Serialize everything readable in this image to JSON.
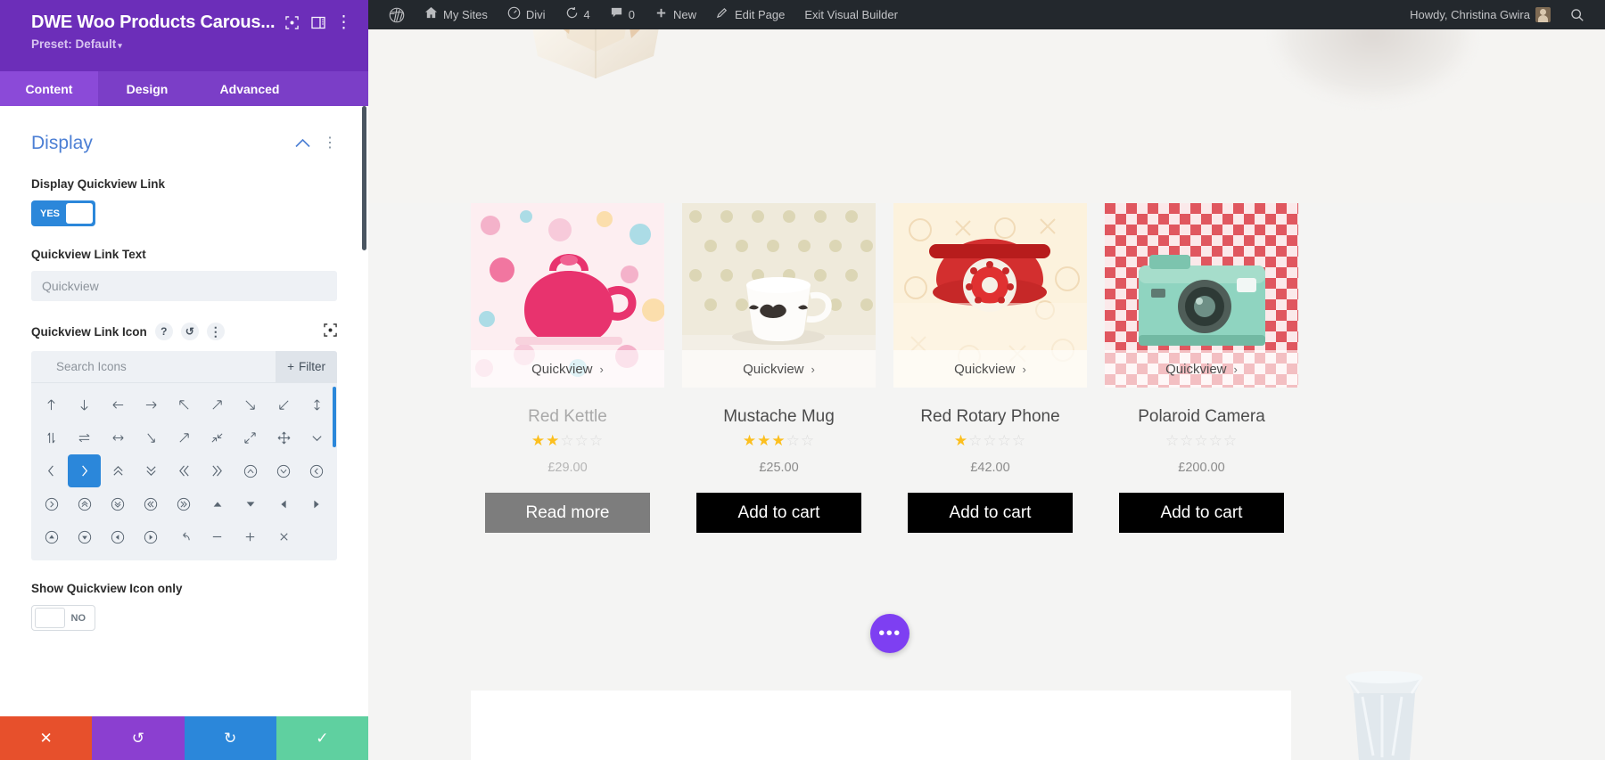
{
  "panel": {
    "title": "DWE Woo Products Carous...",
    "preset": "Preset: Default",
    "preset_caret": "▾",
    "icons": {
      "expand": "⛶",
      "layout": "▥",
      "dots": "⋮"
    },
    "tabs": [
      {
        "label": "Content",
        "active": true
      },
      {
        "label": "Design",
        "active": false
      },
      {
        "label": "Advanced",
        "active": false
      }
    ],
    "section": {
      "title": "Display",
      "chevron": "⌃",
      "dots": "⋮"
    },
    "fields": {
      "display_quickview_link": {
        "label": "Display Quickview Link",
        "value": "YES"
      },
      "quickview_link_text": {
        "label": "Quickview Link Text",
        "placeholder": "Quickview",
        "value": ""
      },
      "quickview_link_icon": {
        "label": "Quickview Link Icon",
        "help": "?",
        "reset": "↺",
        "dots": "⋮",
        "expand": "⛶",
        "search_placeholder": "Search Icons",
        "filter_label": "Filter",
        "filter_plus": "+",
        "selected_index": 20
      },
      "show_quickview_icon_only": {
        "label": "Show Quickview Icon only",
        "value": "NO"
      }
    },
    "icon_grid": [
      "↑",
      "↓",
      "←",
      "→",
      "↖",
      "↗",
      "↘",
      "↙",
      "↕",
      "⇕",
      "⇌",
      "↔",
      "⇲",
      "⇗",
      "⇲",
      "⇱",
      "⤢",
      "✥",
      "⌄",
      "‹",
      "›",
      "⌃⌃",
      "⌄⌄",
      "«",
      "»",
      "⌃",
      "⌄",
      "‹",
      "›",
      "⌃",
      "⌄",
      "«",
      "»",
      "▲",
      "▼",
      "◀",
      "▶",
      "▲",
      "▼",
      "◀",
      "▶",
      "↩",
      "−",
      "+",
      "×"
    ],
    "actions": {
      "cancel": "✕",
      "undo": "↺",
      "redo": "↻",
      "save": "✓"
    }
  },
  "adminbar": {
    "wp_logo": "wordpress-logo",
    "items": [
      {
        "icon": "home",
        "label": "My Sites"
      },
      {
        "icon": "speedometer",
        "label": "Divi"
      },
      {
        "icon": "refresh",
        "label": "4"
      },
      {
        "icon": "comment",
        "label": "0"
      },
      {
        "icon": "plus",
        "label": "New"
      },
      {
        "icon": "pencil",
        "label": "Edit Page"
      },
      {
        "icon": "",
        "label": "Exit Visual Builder"
      }
    ],
    "howdy": "Howdy, Christina Gwira",
    "search_icon": "🔍"
  },
  "products": [
    {
      "name": "Red Kettle",
      "quickview": "Quickview",
      "quickview_chevron": "›",
      "rating": 2,
      "price": "£29.00",
      "button": "Read more",
      "button_style": "gray",
      "muted": true
    },
    {
      "name": "Mustache Mug",
      "quickview": "Quickview",
      "quickview_chevron": "›",
      "rating": 3,
      "price": "£25.00",
      "button": "Add to cart",
      "button_style": "black",
      "muted": false
    },
    {
      "name": "Red Rotary Phone",
      "quickview": "Quickview",
      "quickview_chevron": "›",
      "rating": 1,
      "price": "£42.00",
      "button": "Add to cart",
      "button_style": "black",
      "muted": false
    },
    {
      "name": "Polaroid Camera",
      "quickview": "Quickview",
      "quickview_chevron": "›",
      "rating": 0,
      "price": "£200.00",
      "button": "Add to cart",
      "button_style": "black",
      "muted": false
    }
  ],
  "fab": {
    "label": "•••"
  },
  "colors": {
    "panel_purple": "#6c2eb9",
    "tab_purple": "#7b3ec7",
    "tab_active": "#8b4ad8",
    "toggle_blue": "#2b87da",
    "section_blue": "#4c7fd4",
    "star_gold": "#fcbf1e",
    "fab_purple": "#7e3ff2",
    "adminbar": "#23282d"
  }
}
